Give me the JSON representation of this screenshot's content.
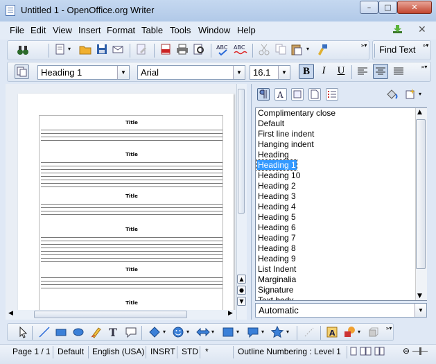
{
  "window": {
    "title": "Untitled 1 - OpenOffice.org Writer",
    "min_label": "–",
    "max_label": "□",
    "close_label": "✕"
  },
  "menu": [
    "File",
    "Edit",
    "View",
    "Insert",
    "Format",
    "Table",
    "Tools",
    "Window",
    "Help"
  ],
  "doc_close_label": "✕",
  "standard_toolbar": {
    "find_text": "Find Text"
  },
  "formatting_toolbar": {
    "paragraph_style": "Heading 1",
    "font_name": "Arial",
    "font_size": "16.1",
    "bold": "B",
    "italic": "I",
    "underline": "U"
  },
  "document": {
    "block_title": "Title"
  },
  "styles_panel": {
    "items": [
      "Complimentary close",
      "Default",
      "First line indent",
      "Hanging indent",
      "Heading",
      "Heading 1",
      "Heading 10",
      "Heading 2",
      "Heading 3",
      "Heading 4",
      "Heading 5",
      "Heading 6",
      "Heading 7",
      "Heading 8",
      "Heading 9",
      "List Indent",
      "Marginalia",
      "Signature",
      "Text body"
    ],
    "selected": "Heading 1",
    "filter": "Automatic"
  },
  "status": {
    "page": "Page 1 / 1",
    "style": "Default",
    "language": "English (USA)",
    "insert_mode": "INSRT",
    "selection_mode": "STD",
    "modified": "*",
    "outline": "Outline Numbering : Level 1"
  },
  "colors": {
    "accent": "#3399ff",
    "titlebar": "#c5d8f0",
    "close": "#c2452f"
  }
}
